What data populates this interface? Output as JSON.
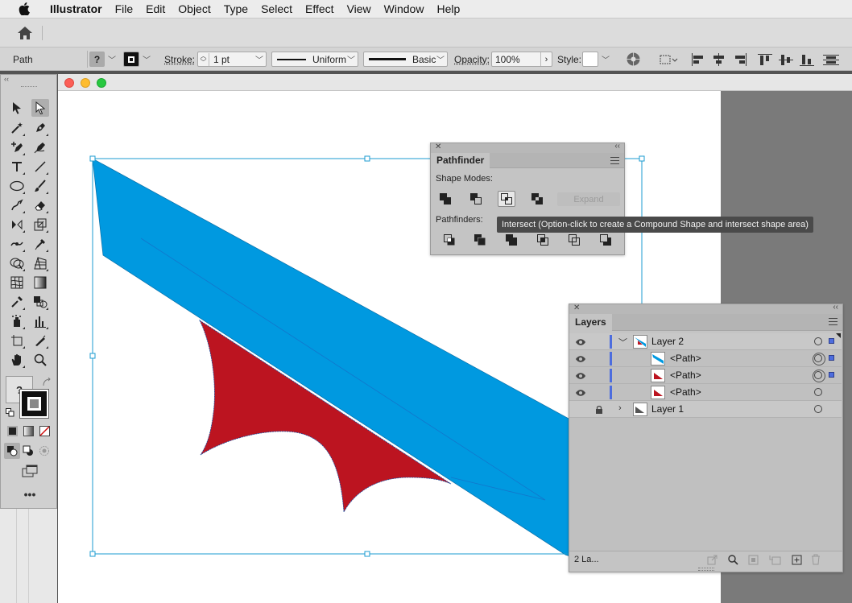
{
  "menubar": {
    "app_name": "Illustrator",
    "items": [
      "File",
      "Edit",
      "Object",
      "Type",
      "Select",
      "Effect",
      "View",
      "Window",
      "Help"
    ]
  },
  "controlbar": {
    "selection_type": "Path",
    "fill_value": "?",
    "stroke_label": "Stroke:",
    "stroke_weight": "1 pt",
    "variable_width_profile": "Uniform",
    "brush_definition": "Basic",
    "opacity_label": "Opacity:",
    "opacity_value": "100%",
    "style_label": "Style:"
  },
  "tools": {
    "fill_unknown": "?"
  },
  "pathfinder": {
    "title": "Pathfinder",
    "shape_modes_label": "Shape Modes:",
    "expand_label": "Expand",
    "pathfinders_label": "Pathfinders:",
    "tooltip": "Intersect (Option-click to create a Compound Shape and intersect shape area)"
  },
  "layers": {
    "title": "Layers",
    "rows": [
      {
        "name": "Layer 2",
        "expanded": true
      },
      {
        "name": "<Path>"
      },
      {
        "name": "<Path>"
      },
      {
        "name": "<Path>"
      },
      {
        "name": "Layer 1",
        "locked": true
      }
    ],
    "footer_count": "2 La..."
  },
  "colors": {
    "blue_shape": "#0099e0",
    "red_shape": "#bc1420",
    "selection": "#1b9bd1",
    "layer_color": "#4d6dde"
  }
}
